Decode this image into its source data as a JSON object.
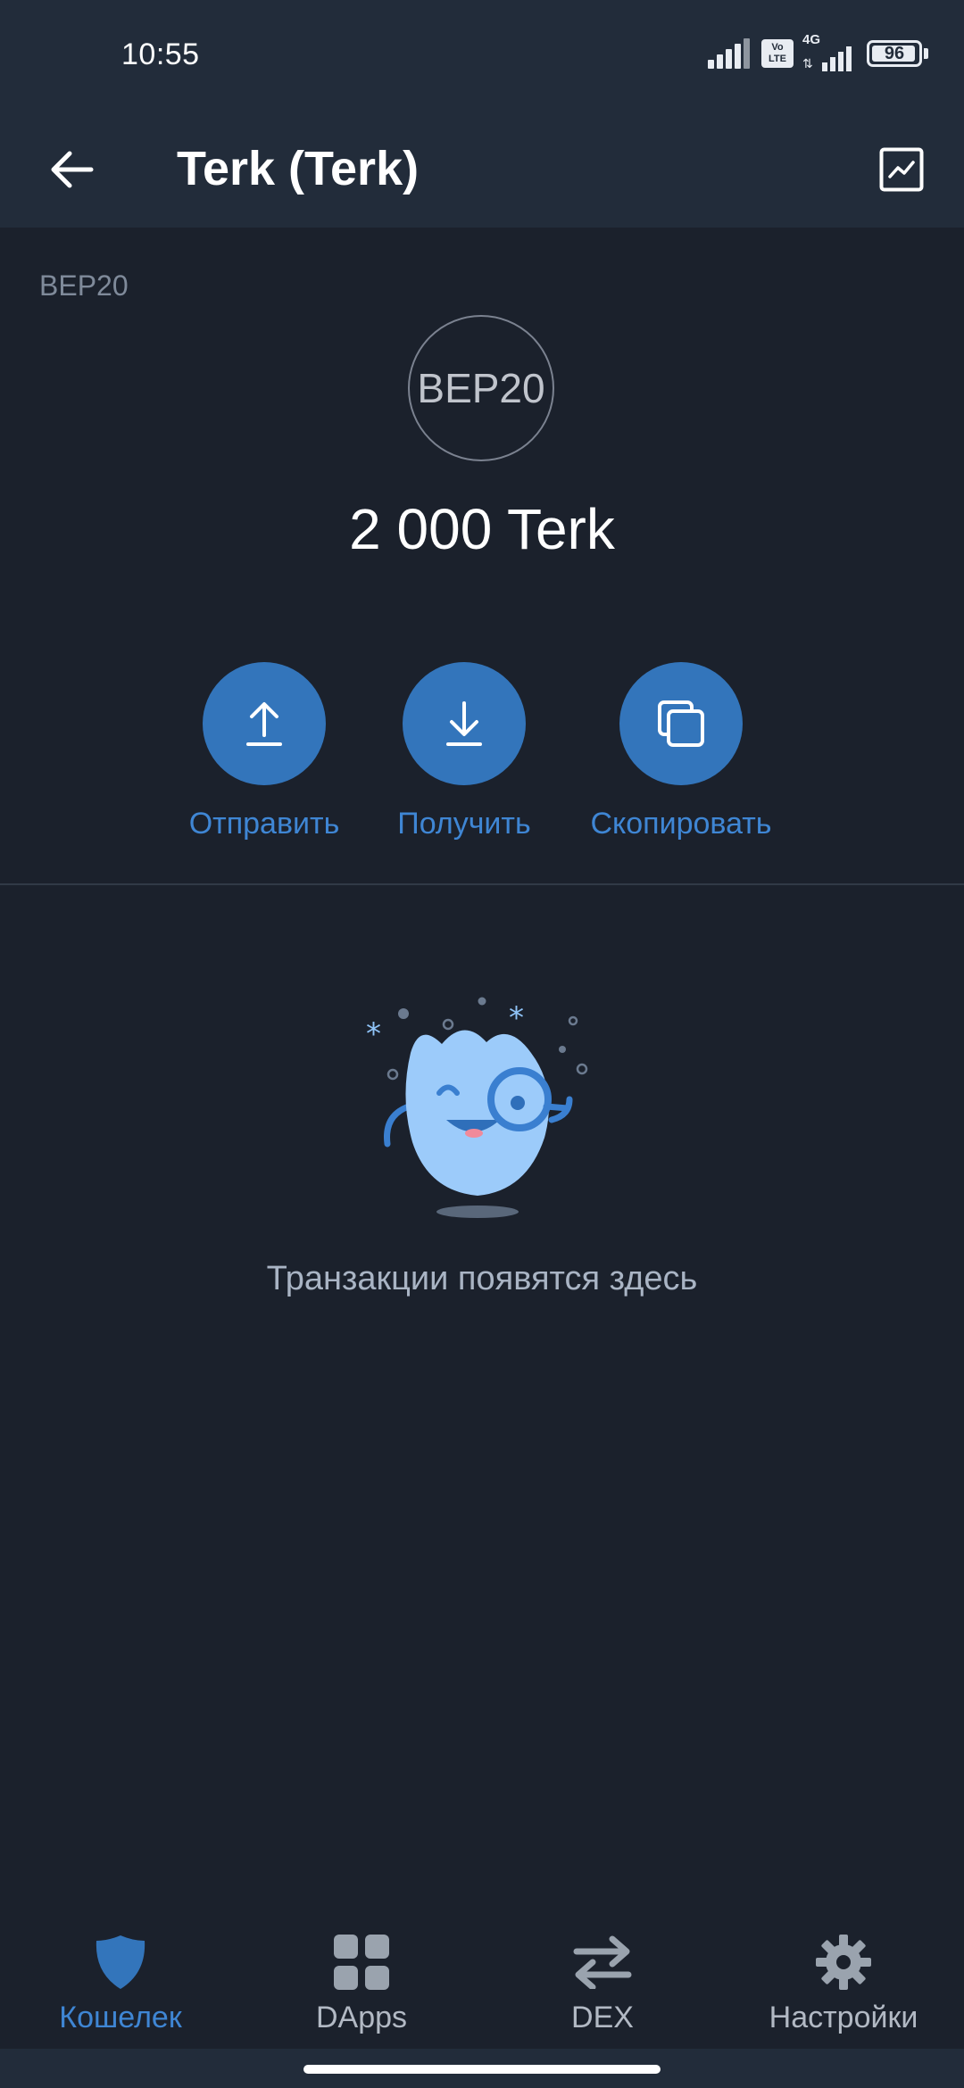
{
  "status_bar": {
    "time": "10:55",
    "network_type": "4G",
    "volte_label": "Vo LTE",
    "battery_percent": "96"
  },
  "header": {
    "title": "Terk (Terk)"
  },
  "token": {
    "network_tag": "BEP20",
    "logo_text": "BEP20",
    "balance": "2 000 Terk"
  },
  "actions": [
    {
      "label": "Отправить",
      "icon": "upload-arrow-icon"
    },
    {
      "label": "Получить",
      "icon": "download-arrow-icon"
    },
    {
      "label": "Скопировать",
      "icon": "copy-icon"
    }
  ],
  "transactions": {
    "empty_text": "Транзакции появятся здесь"
  },
  "bottom_nav": [
    {
      "label": "Кошелек",
      "icon": "shield-icon",
      "active": true
    },
    {
      "label": "DApps",
      "icon": "grid-icon",
      "active": false
    },
    {
      "label": "DEX",
      "icon": "swap-arrows-icon",
      "active": false
    },
    {
      "label": "Настройки",
      "icon": "gear-icon",
      "active": false
    }
  ],
  "colors": {
    "background": "#1b212c",
    "header": "#222c3a",
    "accent": "#3375bb",
    "accent_text": "#3f86d4"
  }
}
